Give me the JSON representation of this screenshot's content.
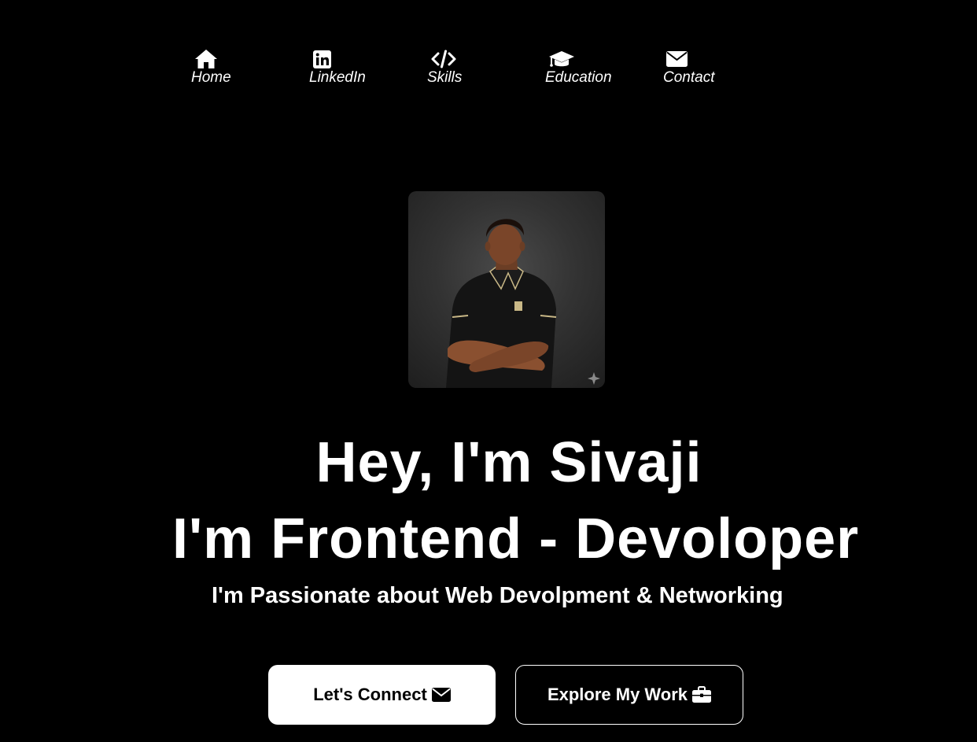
{
  "nav": {
    "items": [
      {
        "label": "Home",
        "icon": "home-icon"
      },
      {
        "label": "LinkedIn",
        "icon": "linkedin-icon"
      },
      {
        "label": "Skills",
        "icon": "code-icon"
      },
      {
        "label": "Education",
        "icon": "graduation-cap-icon"
      },
      {
        "label": "Contact",
        "icon": "envelope-icon"
      }
    ]
  },
  "hero": {
    "photo_alt": "profile-photo",
    "heading_line1": "Hey, I'm Sivaji",
    "heading_line2": "I'm Frontend - Devoloper",
    "tagline": "I'm Passionate about Web Devolpment & Networking"
  },
  "buttons": {
    "connect_label": "Let's Connect",
    "connect_icon": "envelope-icon",
    "work_label": "Explore My Work",
    "work_icon": "briefcase-icon"
  },
  "colors": {
    "background": "#000000",
    "text": "#ffffff",
    "primary_button_bg": "#ffffff",
    "primary_button_text": "#000000"
  }
}
